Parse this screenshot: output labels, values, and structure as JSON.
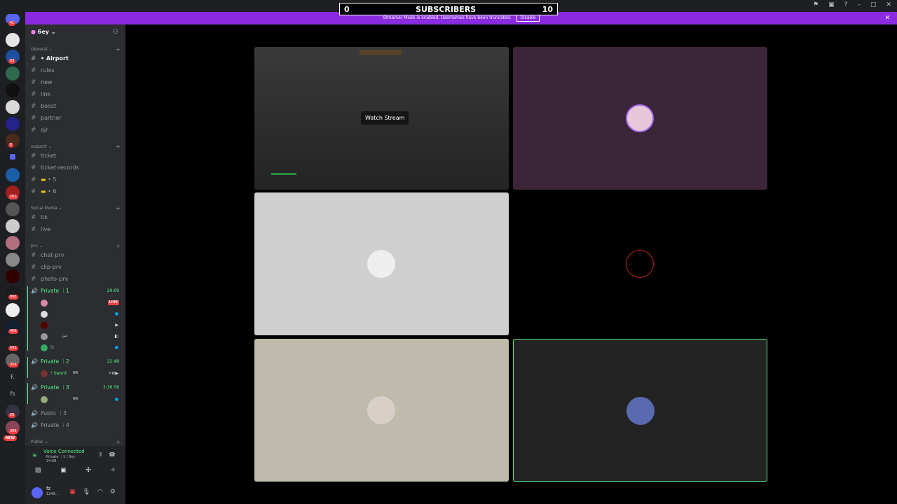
{
  "subscribers": {
    "left": "0",
    "title": "SUBSCRIBERS",
    "right": "10"
  },
  "banner": {
    "text": "Streamer Mode is enabled. Usernames have been truncated.",
    "disable": "Disable"
  },
  "server_rail": {
    "badges": [
      "41",
      "83",
      "8",
      "261",
      "893",
      "460",
      "692",
      "354",
      "26",
      "306"
    ],
    "labels": [
      "F.",
      "fs"
    ],
    "new_badge": "NEW"
  },
  "guild": {
    "name": "6ey"
  },
  "categories": {
    "general": "General",
    "support": "support",
    "social": "Social Media",
    "prv": "prv",
    "public": "Public"
  },
  "channels": {
    "airport": "• Airport",
    "rules": "rules",
    "new": "new",
    "link": "link",
    "boost": "boost",
    "partner": "partner",
    "ajr": "ajr",
    "ticket": "ticket",
    "ticket_records": "ticket-records",
    "c5": "• 5",
    "c6": "• 6",
    "tik": "tik",
    "live": "live",
    "chat_prv": "chat-prv",
    "clip_prv": "clip-prv",
    "photo_prv": "photo-prv"
  },
  "voice_channels": {
    "private1": {
      "name": "Private ︱1",
      "time": "29:09"
    },
    "private2": {
      "name": "Private ︱2",
      "time": "22:48"
    },
    "private3": {
      "name": "Private ︱3",
      "time": "3:36:58"
    },
    "public3": {
      "name": "Public ︱3"
    },
    "private4": {
      "name": "Private ︱4"
    }
  },
  "members": {
    "live_label": "LIVE",
    "m4": "غين",
    "m5": "fz",
    "p2": "! Sword",
    "p2_tag": "NR",
    "p3_tag": "NR"
  },
  "voice_panel": {
    "status": "Voice Connected",
    "channel": "Private ︱1 / 6ey",
    "time": "24:08"
  },
  "user_panel": {
    "name": "fz",
    "status": "1249..."
  },
  "stage": {
    "watch_label": "Watch Stream"
  },
  "colors": {
    "accent": "#8a2be2",
    "tile2": "#3c2538",
    "tile3": "#cfcfcf",
    "tile5": "#bebbac",
    "tile6": "#232323",
    "speaking": "#57f287"
  }
}
